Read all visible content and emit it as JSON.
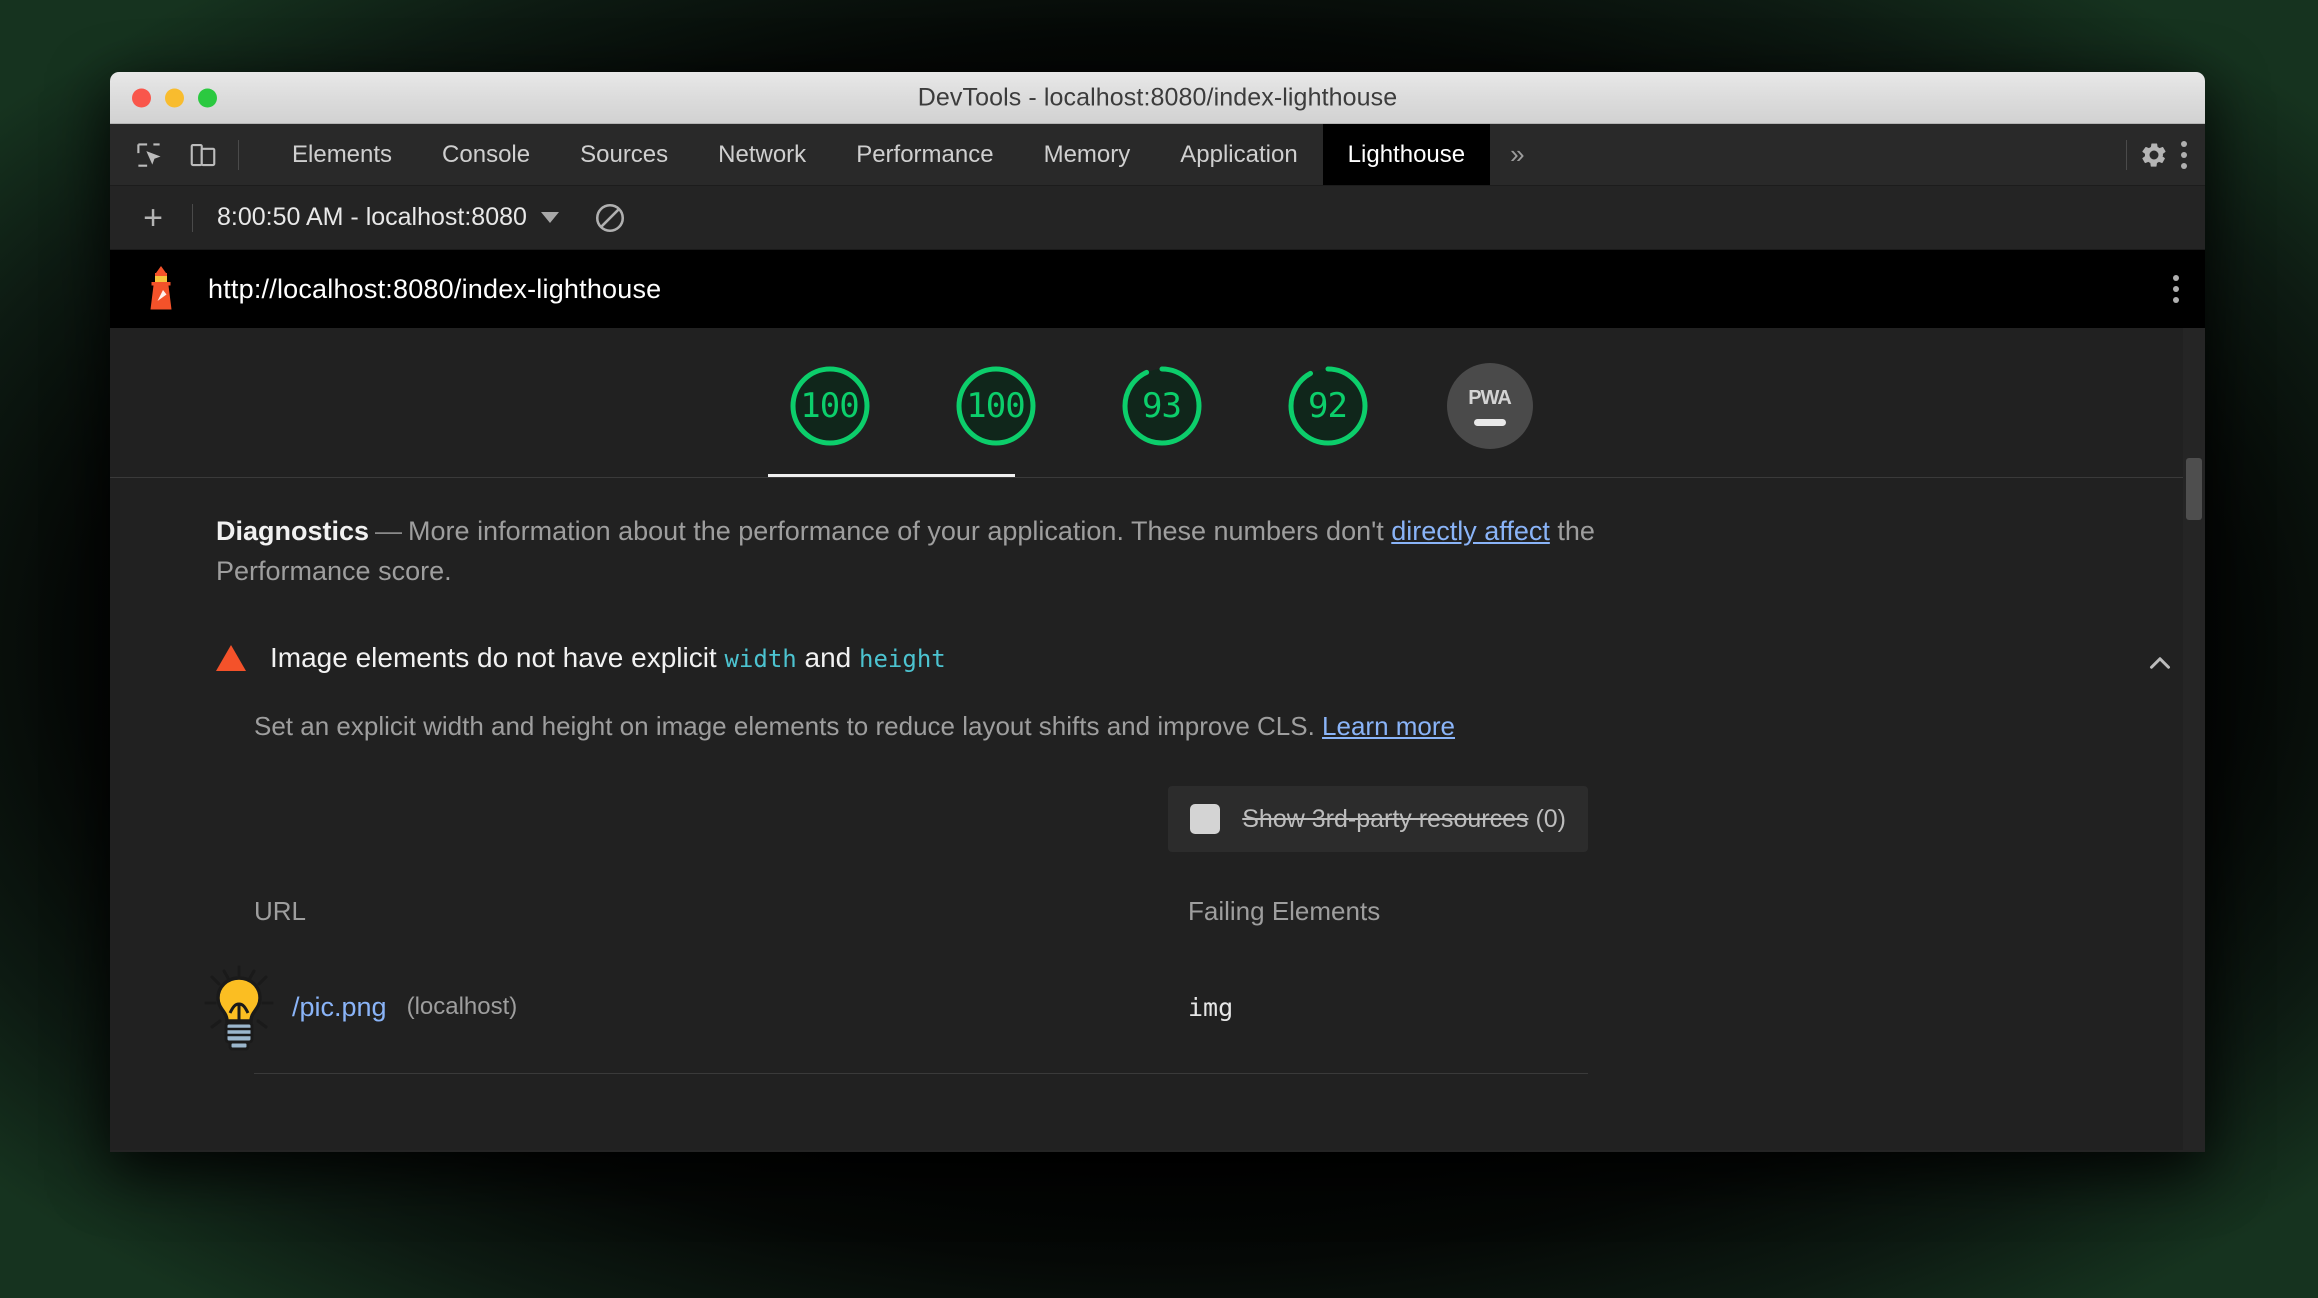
{
  "window": {
    "title": "DevTools - localhost:8080/index-lighthouse"
  },
  "toolbar_icons": {
    "inspect": "inspect-element-icon",
    "device": "device-toolbar-icon",
    "settings": "gear-icon",
    "menu": "kebab-menu-icon",
    "overflow_tabs": "»"
  },
  "tabs": [
    {
      "label": "Elements",
      "active": false
    },
    {
      "label": "Console",
      "active": false
    },
    {
      "label": "Sources",
      "active": false
    },
    {
      "label": "Network",
      "active": false
    },
    {
      "label": "Performance",
      "active": false
    },
    {
      "label": "Memory",
      "active": false
    },
    {
      "label": "Application",
      "active": false
    },
    {
      "label": "Lighthouse",
      "active": true
    }
  ],
  "lighthouse_toolbar": {
    "new_report_label": "+",
    "run_selected": "8:00:50 AM - localhost:8080",
    "clear_icon": "clear-all-icon"
  },
  "report_header": {
    "logo": "lighthouse-logo-icon",
    "url": "http://localhost:8080/index-lighthouse",
    "menu_icon": "kebab-menu-icon"
  },
  "scores": [
    {
      "name": "performance",
      "value": "100",
      "percent": 100,
      "color": "#0cce6b",
      "selected": true
    },
    {
      "name": "accessibility",
      "value": "100",
      "percent": 100,
      "color": "#0cce6b",
      "selected": false
    },
    {
      "name": "best-practices",
      "value": "93",
      "percent": 93,
      "color": "#0cce6b",
      "selected": false
    },
    {
      "name": "seo",
      "value": "92",
      "percent": 92,
      "color": "#0cce6b",
      "selected": false
    }
  ],
  "pwa": {
    "label": "PWA",
    "state": "dash"
  },
  "diagnostics": {
    "title": "Diagnostics",
    "dash": "—",
    "text_before_link": "More information about the performance of your application. These numbers don't ",
    "link_text": "directly affect",
    "text_after_link": " the Performance score."
  },
  "audit": {
    "severity_icon": "warning-triangle-icon",
    "title_part1": "Image elements do not have explicit ",
    "code1": "width",
    "title_part2": " and ",
    "code2": "height",
    "collapse_icon": "chevron-up-icon",
    "description_before_link": "Set an explicit width and height on image elements to reduce layout shifts and improve CLS. ",
    "description_link": "Learn more",
    "third_party": {
      "checkbox": "show-3rd-party-checkbox",
      "label_struck": "Show 3rd-party resources",
      "count": "(0)"
    },
    "table": {
      "columns": [
        "URL",
        "Failing Elements"
      ],
      "rows": [
        {
          "icon": "lightbulb-icon",
          "url": "/pic.png",
          "host": "(localhost)",
          "failing_element": "img"
        }
      ]
    }
  },
  "colors": {
    "score_green": "#0cce6b",
    "link_blue": "#8ab4f8",
    "code_cyan": "#4cc3d0",
    "warning_orange": "#f4522a",
    "panel_bg": "#212121"
  }
}
